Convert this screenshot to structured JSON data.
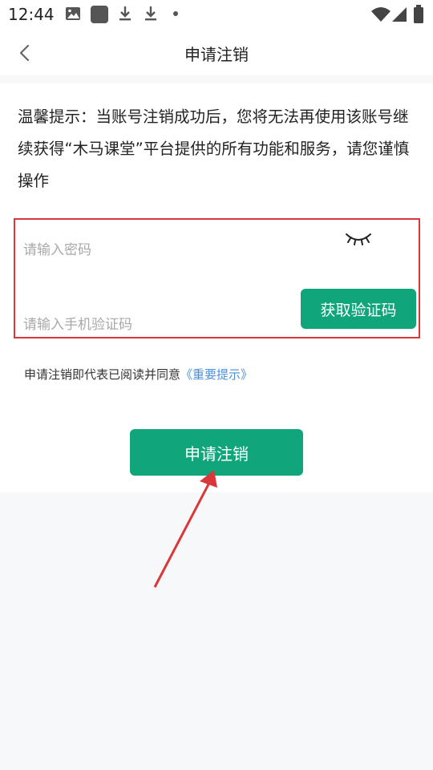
{
  "status_bar": {
    "time": "12:44"
  },
  "header": {
    "title": "申请注销",
    "back_icon": "chevron-left-icon"
  },
  "notice": {
    "text": "温馨提示：当账号注销成功后，您将无法再使用该账号继续获得“木马课堂”平台提供的所有功能和服务，请您谨慎操作"
  },
  "form": {
    "password_placeholder": "请输入密码",
    "password_value": "",
    "eye_icon": "eye-closed-icon",
    "code_placeholder": "请输入手机验证码",
    "code_value": "",
    "get_code_label": "获取验证码"
  },
  "agreement": {
    "prefix": "申请注销即代表已阅读并同意",
    "link": "《重要提示》"
  },
  "submit_label": "申请注销",
  "colors": {
    "accent": "#11a57c",
    "highlight_border": "#d9373a",
    "link": "#4a90d9",
    "annotation_arrow": "#d9373a"
  }
}
